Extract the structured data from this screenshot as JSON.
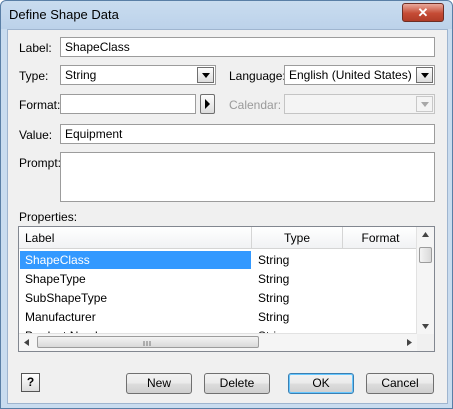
{
  "window": {
    "title": "Define Shape Data",
    "close_glyph": "✕"
  },
  "form": {
    "label_label": "Label:",
    "label_value": "ShapeClass",
    "type_label": "Type:",
    "type_value": "String",
    "language_label": "Language:",
    "language_value": "English (United States)",
    "format_label": "Format:",
    "format_value": "",
    "calendar_label": "Calendar:",
    "calendar_value": "",
    "value_label": "Value:",
    "value_value": "Equipment",
    "prompt_label": "Prompt:",
    "prompt_value": "",
    "properties_label": "Properties:"
  },
  "properties": {
    "columns": [
      "Label",
      "Type",
      "Format"
    ],
    "rows": [
      {
        "label": "ShapeClass",
        "type": "String"
      },
      {
        "label": "ShapeType",
        "type": "String"
      },
      {
        "label": "SubShapeType",
        "type": "String"
      },
      {
        "label": "Manufacturer",
        "type": "String"
      },
      {
        "label": "Product Number",
        "type": "String"
      }
    ],
    "selected_index": 0
  },
  "buttons": {
    "help": "?",
    "new": "New",
    "delete": "Delete",
    "ok": "OK",
    "cancel": "Cancel"
  },
  "colors": {
    "selection": "#3399ff",
    "close": "#c54b35"
  },
  "icons": {
    "help": "help-icon",
    "format_picker": "right-arrow-icon",
    "dropdown": "chevron-down-icon"
  }
}
